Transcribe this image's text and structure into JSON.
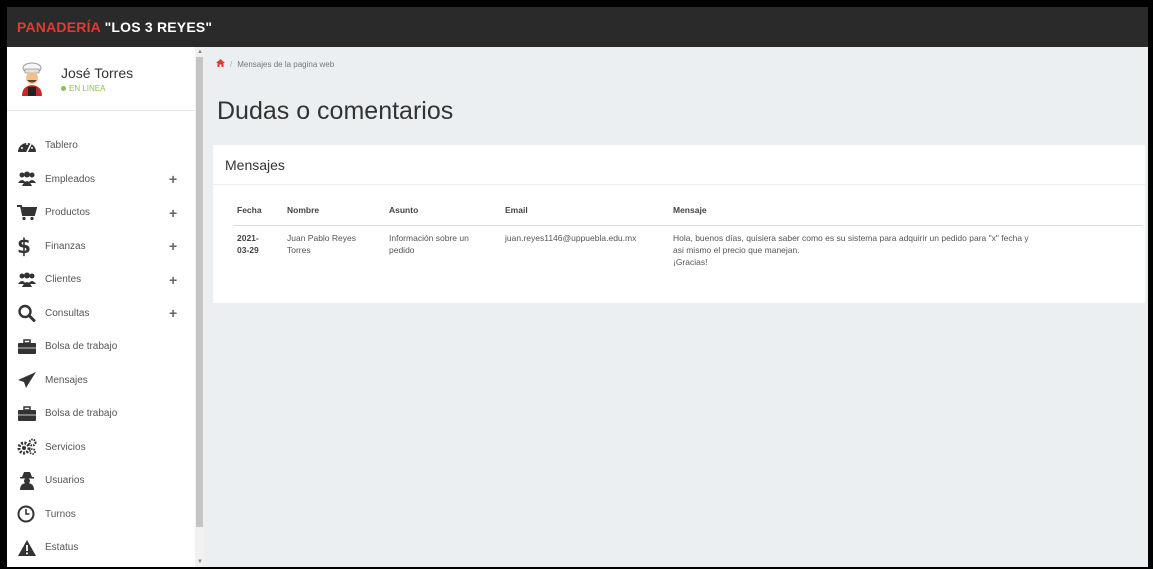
{
  "brand": {
    "part1": "PANADERÍA",
    "part2": "\"LOS 3 REYES\""
  },
  "colors": {
    "brand_red": "#e53935",
    "status_green": "#8bc34a",
    "topbar": "#2a2a2a"
  },
  "user": {
    "name": "José Torres",
    "status": "EN LINEA",
    "avatar_icon": "baker-avatar-icon"
  },
  "sidebar": {
    "items": [
      {
        "label": "Tablero",
        "icon": "dashboard-icon",
        "expandable": false
      },
      {
        "label": "Empleados",
        "icon": "users-icon",
        "expandable": true,
        "expander": "+"
      },
      {
        "label": "Productos",
        "icon": "cart-icon",
        "expandable": true,
        "expander": "+"
      },
      {
        "label": "Finanzas",
        "icon": "dollar-icon",
        "expandable": true,
        "expander": "+"
      },
      {
        "label": "Clientes",
        "icon": "users-icon",
        "expandable": true,
        "expander": "+"
      },
      {
        "label": "Consultas",
        "icon": "search-icon",
        "expandable": true,
        "expander": "+"
      },
      {
        "label": "Bolsa de trabajo",
        "icon": "briefcase-icon",
        "expandable": false
      },
      {
        "label": "Mensajes",
        "icon": "paper-plane-icon",
        "expandable": false
      },
      {
        "label": "Bolsa de trabajo",
        "icon": "briefcase-icon",
        "expandable": false
      },
      {
        "label": "Servicios",
        "icon": "gears-icon",
        "expandable": false
      },
      {
        "label": "Usuarios",
        "icon": "user-secret-icon",
        "expandable": false
      },
      {
        "label": "Turnos",
        "icon": "clock-icon",
        "expandable": false
      },
      {
        "label": "Estatus",
        "icon": "warning-icon",
        "expandable": false
      }
    ]
  },
  "breadcrumb": {
    "home_icon": "home-icon",
    "current": "Mensajes de la pagina web"
  },
  "page": {
    "title": "Dudas o comentarios"
  },
  "card": {
    "title": "Mensajes"
  },
  "table": {
    "headers": [
      "Fecha",
      "Nombre",
      "Asunto",
      "Email",
      "Mensaje"
    ],
    "rows": [
      {
        "fecha_l1": "2021-",
        "fecha_l2": "03-29",
        "nombre_l1": "Juan Pablo Reyes",
        "nombre_l2": "Torres",
        "asunto_l1": "Información sobre un",
        "asunto_l2": "pedido",
        "email": "juan.reyes1146@uppuebla.edu.mx",
        "mensaje_l1": "Hola, buenos días, quisiera saber como es su sistema para adquirir un pedido para \"x\" fecha y",
        "mensaje_l2": "asi mismo el precio que manejan.",
        "mensaje_l3": "¡Gracias!"
      }
    ]
  }
}
